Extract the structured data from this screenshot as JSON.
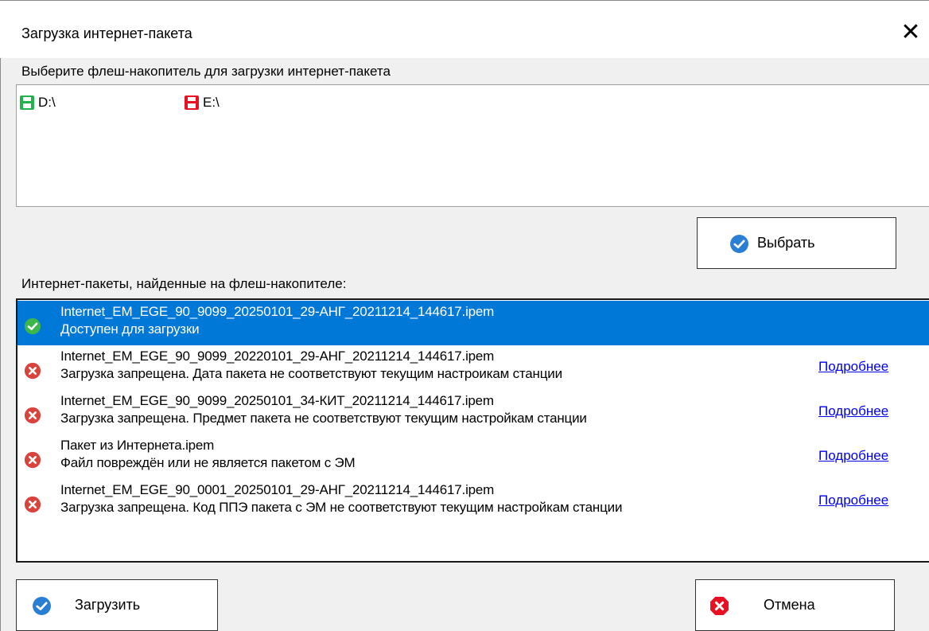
{
  "window": {
    "title": "Загрузка интернет-пакета",
    "close_glyph": "✕"
  },
  "drives_section": {
    "label": "Выберите флеш-накопитель для загрузки интернет-пакета",
    "drives": [
      {
        "label": "D:\\",
        "icon": "floppy-disk-icon",
        "color": "#22b14c"
      },
      {
        "label": "E:\\",
        "icon": "floppy-disk-icon",
        "color": "#e81123"
      }
    ]
  },
  "select_button": {
    "label": "Выбрать",
    "icon": "check-circle-icon"
  },
  "packages_section": {
    "label": "Интернет-пакеты, найденные на флеш-накопителе:",
    "items": [
      {
        "file": "Internet_EM_EGE_90_9099_20250101_29-АНГ_20211214_144617.ipem",
        "status": "Доступен для загрузки",
        "state": "ok",
        "selected": true,
        "details_link": ""
      },
      {
        "file": "Internet_EM_EGE_90_9099_20220101_29-АНГ_20211214_144617.ipem",
        "status": "Загрузка запрещена. Дата пакета не соответствуют текущим настроикам станции",
        "state": "error",
        "selected": false,
        "details_link": "Подробнее"
      },
      {
        "file": "Internet_EM_EGE_90_9099_20250101_34-КИТ_20211214_144617.ipem",
        "status": "Загрузка запрещена. Предмет пакета не соответствуют текущим настройкам станции",
        "state": "error",
        "selected": false,
        "details_link": "Подробнее"
      },
      {
        "file": "Пакет из Интернета.ipem",
        "status": "Файл повреждён или не является пакетом с ЭМ",
        "state": "error",
        "selected": false,
        "details_link": "Подробнее"
      },
      {
        "file": "Internet_EM_EGE_90_0001_20250101_29-АНГ_20211214_144617.ipem",
        "status": "Загрузка запрещена. Код ППЭ пакета с ЭМ не соответствуют текущим настройкам станции",
        "state": "error",
        "selected": false,
        "details_link": "Подробнее"
      }
    ]
  },
  "load_button": {
    "label": "Загрузить",
    "icon": "check-circle-icon"
  },
  "cancel_button": {
    "label": "Отмена",
    "icon": "cancel-icon"
  },
  "colors": {
    "selection": "#0078d7",
    "ok": "#3cb54a",
    "error": "#d9433b",
    "button_check": "#2a7fd4",
    "cancel": "#e81123",
    "link": "#0000ee"
  }
}
